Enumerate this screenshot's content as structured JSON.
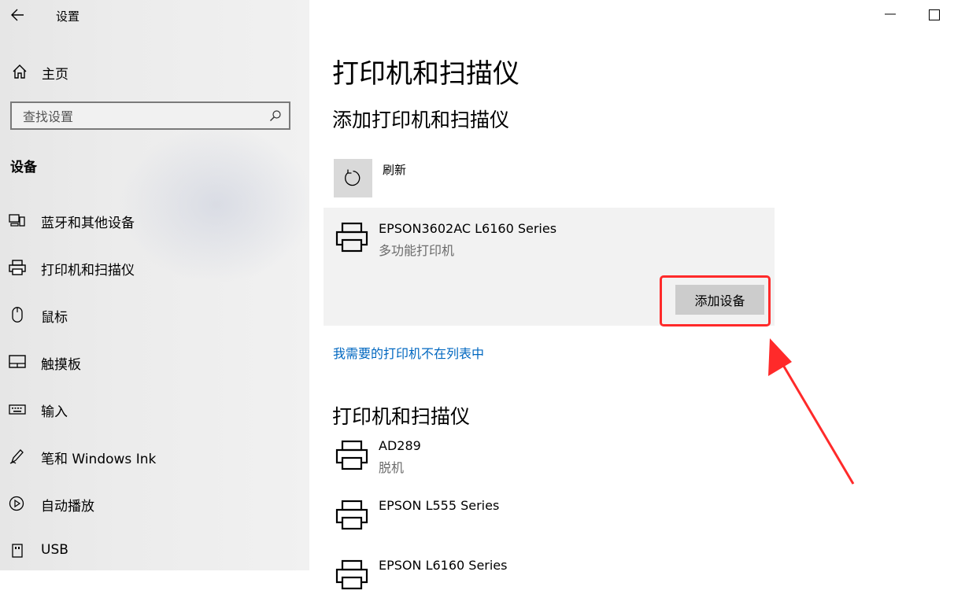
{
  "app": {
    "title": "设置"
  },
  "sidebar": {
    "home_label": "主页",
    "search_placeholder": "查找设置",
    "section": "设备",
    "items": [
      {
        "label": "蓝牙和其他设备",
        "icon": "bluetooth-devices-icon"
      },
      {
        "label": "打印机和扫描仪",
        "icon": "printer-icon"
      },
      {
        "label": "鼠标",
        "icon": "mouse-icon"
      },
      {
        "label": "触摸板",
        "icon": "touchpad-icon"
      },
      {
        "label": "输入",
        "icon": "keyboard-icon"
      },
      {
        "label": "笔和 Windows Ink",
        "icon": "pen-icon"
      },
      {
        "label": "自动播放",
        "icon": "autoplay-icon"
      },
      {
        "label": "USB",
        "icon": "usb-icon"
      }
    ]
  },
  "main": {
    "page_title": "打印机和扫描仪",
    "add_section_title": "添加打印机和扫描仪",
    "refresh_label": "刷新",
    "found_device": {
      "name": "EPSON3602AC L6160 Series",
      "type": "多功能打印机",
      "add_button": "添加设备"
    },
    "not_listed_link": "我需要的打印机不在列表中",
    "list_title": "打印机和扫描仪",
    "devices": [
      {
        "name": "AD289",
        "status": "脱机"
      },
      {
        "name": "EPSON L555 Series",
        "status": ""
      },
      {
        "name": "EPSON L6160 Series",
        "status": ""
      }
    ]
  },
  "colors": {
    "link": "#0067c0",
    "highlight": "#ff2a2a",
    "sidebar_bg": "#ebebeb",
    "card_bg": "#f2f2f2",
    "button_bg": "#cccccc"
  }
}
